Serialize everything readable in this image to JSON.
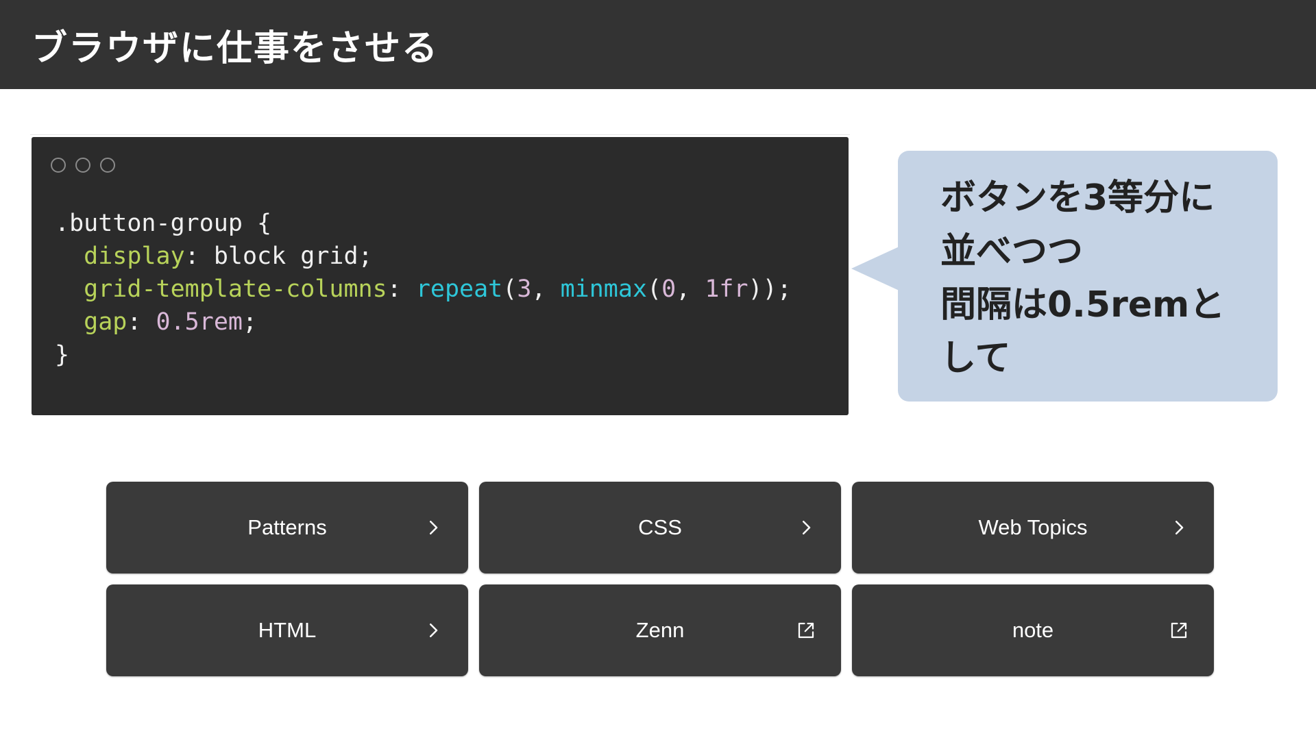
{
  "header": {
    "title": "ブラウザに仕事をさせる"
  },
  "code": {
    "selector": ".button-group",
    "open_brace": " {",
    "close_brace": "}",
    "display_prop": "display",
    "display_value": "block grid",
    "columns_prop": "grid-template-columns",
    "repeat_fn": "repeat",
    "repeat_count": "3",
    "minmax_fn": "minmax",
    "minmax_min": "0",
    "minmax_max": "1fr",
    "gap_prop": "gap",
    "gap_value": "0.5rem"
  },
  "callout": {
    "lines": [
      "ボタンを3等分に",
      "並べつつ",
      "間隔は0.5remと",
      "して"
    ]
  },
  "buttons": [
    {
      "label": "Patterns",
      "icon": "chevron-right-icon"
    },
    {
      "label": "CSS",
      "icon": "chevron-right-icon"
    },
    {
      "label": "Web Topics",
      "icon": "chevron-right-icon"
    },
    {
      "label": "HTML",
      "icon": "chevron-right-icon"
    },
    {
      "label": "Zenn",
      "icon": "external-link-icon"
    },
    {
      "label": "note",
      "icon": "external-link-icon"
    }
  ],
  "colors": {
    "header_bg": "#333333",
    "code_bg": "#2b2b2b",
    "code_property": "#b8d35a",
    "code_function": "#2ec7d9",
    "code_number": "#d9b8d8",
    "callout_bg": "#c5d3e5",
    "button_bg": "#3a3a3a"
  }
}
